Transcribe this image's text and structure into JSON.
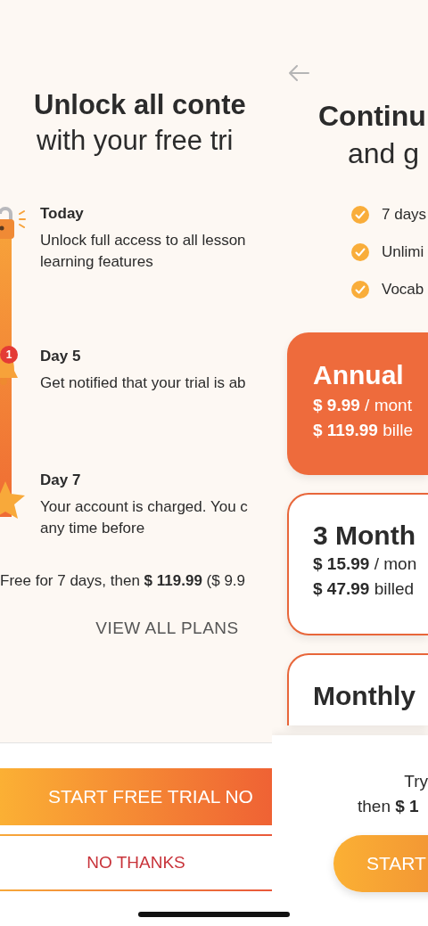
{
  "trial_screen": {
    "title_lines": [
      "Unlock all conte",
      "with your free tri"
    ],
    "timeline": [
      {
        "kind": "lock",
        "heading": "Today",
        "lines": [
          "Unlock full access to all lesson",
          "learning features"
        ]
      },
      {
        "kind": "bell",
        "badge": "1",
        "heading": "Day 5",
        "lines": [
          "Get notified that your trial is ab"
        ]
      },
      {
        "kind": "star",
        "heading": "Day 7",
        "lines": [
          "Your account is charged. You c",
          "any time before"
        ]
      }
    ],
    "price_note": "Free for 7 days, then **$ 119.99** ($ 9.9",
    "view_all_link": "VIEW ALL PLANS",
    "start_button": "START FREE TRIAL NO",
    "decline_button": "NO THANKS"
  },
  "plans_screen": {
    "title_lines": [
      "Continu",
      "and g"
    ],
    "features": [
      "7 days",
      "Unlimi",
      "Vocab"
    ],
    "plans": [
      {
        "name": "Annual",
        "selected": true,
        "price_line": "**$ 9.99** / mont",
        "billing_line": "**$ 119.99** bille"
      },
      {
        "name": "3 Month",
        "selected": false,
        "price_line": "**$ 15.99** / mon",
        "billing_line": "**$ 47.99** billed"
      },
      {
        "name": "Monthly",
        "selected": false
      }
    ],
    "note_lines": [
      "Try",
      "then **$ 1**"
    ],
    "start_button": "START"
  }
}
